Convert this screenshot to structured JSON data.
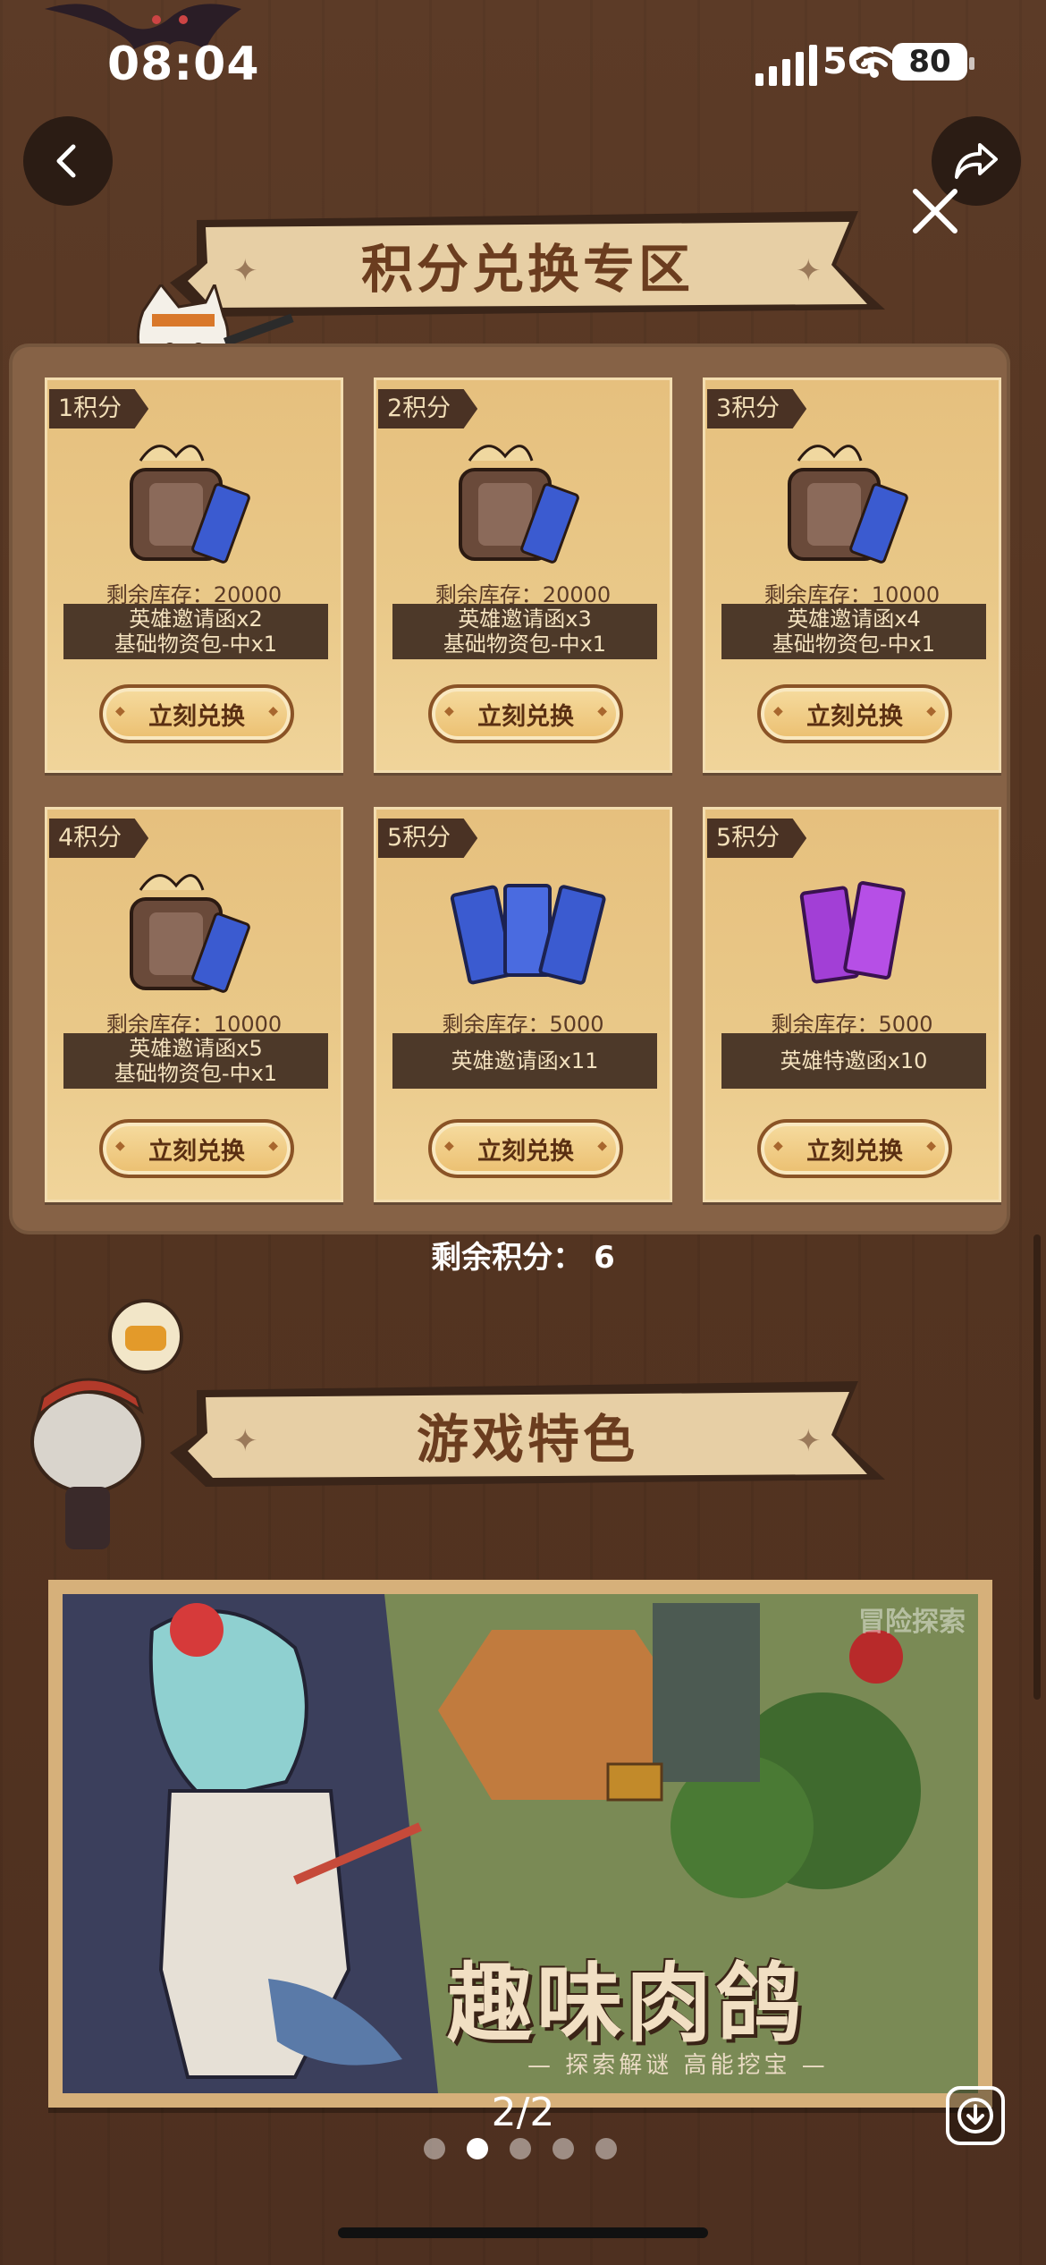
{
  "status_bar": {
    "time": "08:04",
    "network": "5G",
    "battery": "80"
  },
  "header": {
    "back_icon": "chevron-left-icon",
    "share_icon": "share-icon",
    "close_icon": "close-icon"
  },
  "exchange": {
    "title": "积分兑换专区",
    "redeem_label": "立刻兑换",
    "items": [
      {
        "price": "1积分",
        "stock": "剩余库存：20000",
        "desc": [
          "英雄邀请函x2",
          "基础物资包-中x1"
        ],
        "art": "bag-and-tickets-icon"
      },
      {
        "price": "2积分",
        "stock": "剩余库存：20000",
        "desc": [
          "英雄邀请函x3",
          "基础物资包-中x1"
        ],
        "art": "bag-and-tickets-icon"
      },
      {
        "price": "3积分",
        "stock": "剩余库存：10000",
        "desc": [
          "英雄邀请函x4",
          "基础物资包-中x1"
        ],
        "art": "bag-and-tickets-icon"
      },
      {
        "price": "4积分",
        "stock": "剩余库存：10000",
        "desc": [
          "英雄邀请函x5",
          "基础物资包-中x1"
        ],
        "art": "bag-and-tickets-icon"
      },
      {
        "price": "5积分",
        "stock": "剩余库存：5000",
        "desc": [
          "英雄邀请函x11"
        ],
        "art": "blue-tickets-icon"
      },
      {
        "price": "5积分",
        "stock": "剩余库存：5000",
        "desc": [
          "英雄特邀函x10"
        ],
        "art": "purple-tickets-icon"
      }
    ],
    "remaining_points": "剩余积分： 6"
  },
  "features": {
    "title": "游戏特色",
    "slide": {
      "title": "趣味肉鸽",
      "subtitle": "— 探索解谜 高能挖宝 —",
      "watermark": "冒险探索"
    },
    "counter": "2/2",
    "download_icon": "download-icon",
    "dots": 5,
    "active_dot": 1
  },
  "colors": {
    "background": "#553521",
    "card": "#e9c888",
    "button_border": "#8a5326",
    "banner_text": "#6b3d1f"
  }
}
